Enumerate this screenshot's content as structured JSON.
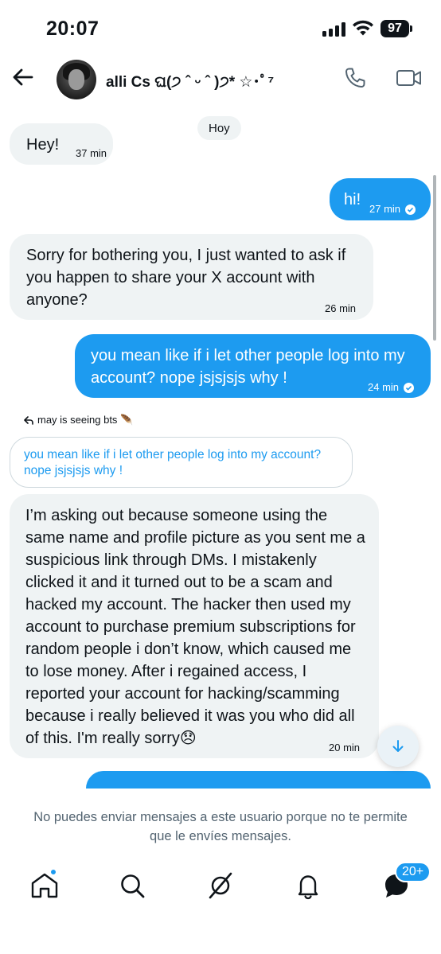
{
  "status_bar": {
    "time": "20:07",
    "battery": "97",
    "icons": [
      "signal-icon",
      "wifi-icon",
      "battery-icon"
    ]
  },
  "header": {
    "contact_name": "alli Cs ଘ(੭ ˆ ᵕ ˆ )੭* ☆･ﾟ⁷",
    "icons": [
      "back-arrow-icon",
      "avatar",
      "phone-icon",
      "video-camera-icon"
    ]
  },
  "conversation": {
    "day_label": "Hoy",
    "messages": [
      {
        "direction": "incoming",
        "text": "Hey!",
        "time": "37 min"
      },
      {
        "direction": "outgoing",
        "text": "hi!",
        "time": "27 min",
        "read": true
      },
      {
        "direction": "incoming",
        "text": "Sorry for bothering you, I just wanted to ask if you happen to share your X account with anyone?",
        "time": "26 min"
      },
      {
        "direction": "outgoing",
        "text": "you mean like if i let other people log into my account? nope jsjsjsjs why !",
        "time": "24 min",
        "read": true
      },
      {
        "direction": "incoming",
        "reply_label": "may is seeing bts 🪶",
        "quoted_text": "you mean like if i let other people log into my account? nope jsjsjsjs why !",
        "text": "I’m asking out because someone using the same name and profile picture as you sent me a suspicious link through DMs. I mistakenly clicked it and it turned out to be a scam and hacked my account. The hacker then used my account to purchase premium subscriptions for random people i don’t know, which caused me to lose money. After i regained access, I reported your account for hacking/scamming because i really believed it was you who did all of this. I'm really sorry😞",
        "time": "20 min"
      }
    ]
  },
  "footer": {
    "notice": "No puedes enviar mensajes a este usuario porque no te permite que le envíes mensajes.",
    "tabs": [
      "home-icon",
      "search-icon",
      "grok-icon",
      "notifications-bell-icon",
      "messages-icon"
    ],
    "messages_badge": "20+"
  },
  "colors": {
    "accent": "#1d9bf0",
    "incoming_bubble": "#eff3f4",
    "secondary_text": "#536471"
  }
}
